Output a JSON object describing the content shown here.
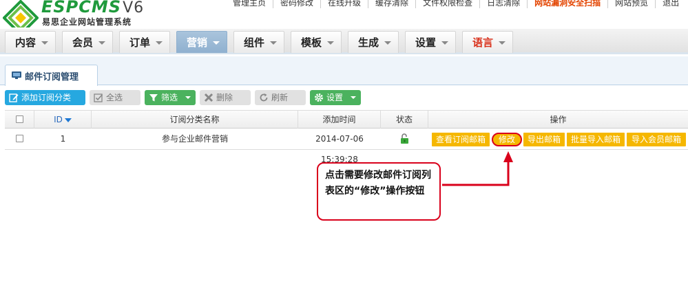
{
  "brand": {
    "logo_text": "ESPCMS",
    "version": "V6",
    "subtitle": "易思企业网站管理系统"
  },
  "top_links": [
    {
      "label": "管理主页",
      "alert": false
    },
    {
      "label": "密码修改",
      "alert": false
    },
    {
      "label": "在线升级",
      "alert": false
    },
    {
      "label": "缓存清除",
      "alert": false
    },
    {
      "label": "文件权限检查",
      "alert": false
    },
    {
      "label": "日志清除",
      "alert": false
    },
    {
      "label": "网站漏洞安全扫描",
      "alert": true
    },
    {
      "label": "网站预览",
      "alert": false
    },
    {
      "label": "退出",
      "alert": false
    }
  ],
  "nav": {
    "items": [
      {
        "label": "内容"
      },
      {
        "label": "会员"
      },
      {
        "label": "订单"
      },
      {
        "label": "营销"
      },
      {
        "label": "组件"
      },
      {
        "label": "模板"
      },
      {
        "label": "生成"
      },
      {
        "label": "设置"
      },
      {
        "label": "语言"
      }
    ],
    "active": "营销"
  },
  "sub_tab": {
    "label": "邮件订阅管理"
  },
  "toolbar": {
    "add": "添加订阅分类",
    "select_all": "全选",
    "filter": "筛选",
    "delete": "删除",
    "refresh": "刷新",
    "settings": "设置"
  },
  "table": {
    "columns": [
      "ID",
      "订阅分类名称",
      "添加时间",
      "状态",
      "操作"
    ],
    "rows": [
      {
        "id": "1",
        "name": "参与企业邮件营销",
        "time": "2014-07-06 15:39:28",
        "status_icon": "unlock-icon",
        "actions": [
          "查看订阅邮箱",
          "修改",
          "导出邮箱",
          "批量导入邮箱",
          "导入会员邮箱"
        ]
      }
    ]
  },
  "callout": {
    "text": "点击需要修改邮件订阅列表区的“修改”操作按钮"
  },
  "colors": {
    "accent_blue": "#26a8e0",
    "accent_green": "#4bb25e",
    "action_orange": "#f5b700",
    "highlight_red": "#d9001b",
    "brand_green": "#1f9a3c"
  }
}
